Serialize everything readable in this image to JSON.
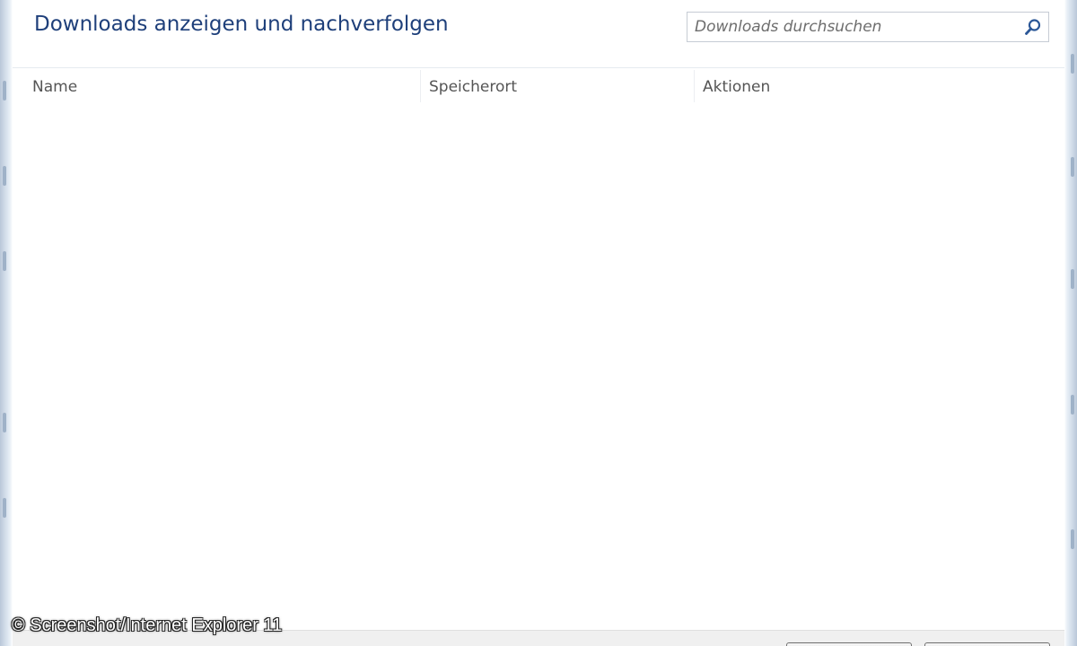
{
  "header": {
    "title": "Downloads anzeigen und nachverfolgen",
    "search_placeholder": "Downloads durchsuchen"
  },
  "list": {
    "columns": [
      "Name",
      "Speicherort",
      "Aktionen"
    ],
    "rows": []
  },
  "watermark": "© Screenshot/Internet Explorer 11",
  "icons": {
    "search": "search-icon"
  },
  "colors": {
    "title": "#1e3f7a",
    "search_icon": "#2b5797",
    "column_header_text": "#555555"
  }
}
